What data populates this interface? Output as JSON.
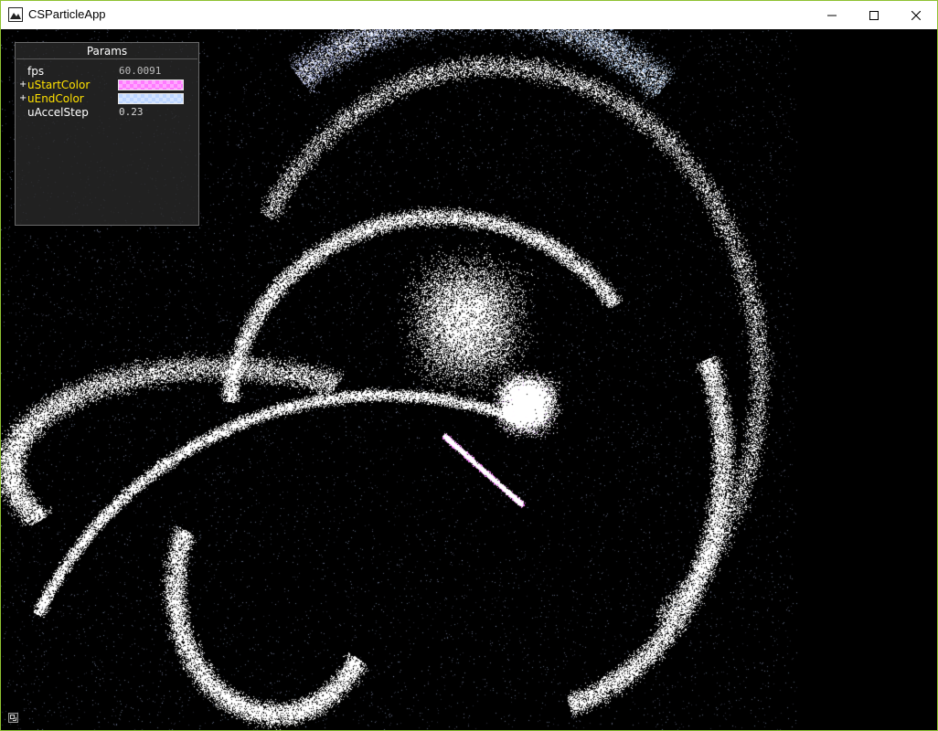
{
  "window": {
    "title": "CSParticleApp",
    "icons": {
      "app": "app-icon",
      "minimize": "minimize-icon",
      "maximize": "maximize-icon",
      "close": "close-icon"
    }
  },
  "params": {
    "title": "Params",
    "rows": [
      {
        "label": "fps",
        "value": "60.0091",
        "expandable": false,
        "highlight": false
      },
      {
        "label": "uStartColor",
        "expandable": true,
        "highlight": true,
        "color": "#ff7aff"
      },
      {
        "label": "uEndColor",
        "expandable": true,
        "highlight": true,
        "color": "#bcd5ff"
      },
      {
        "label": "uAccelStep",
        "value": "0.23",
        "expandable": false,
        "highlight": false
      }
    ],
    "expand_glyph": "+"
  },
  "colors": {
    "start_color": "#ff7aff",
    "end_color": "#bcd5ff",
    "highlight_label": "#ffe100",
    "window_border": "#8fc232"
  },
  "status": {
    "icon": "corner-resize-icon"
  }
}
